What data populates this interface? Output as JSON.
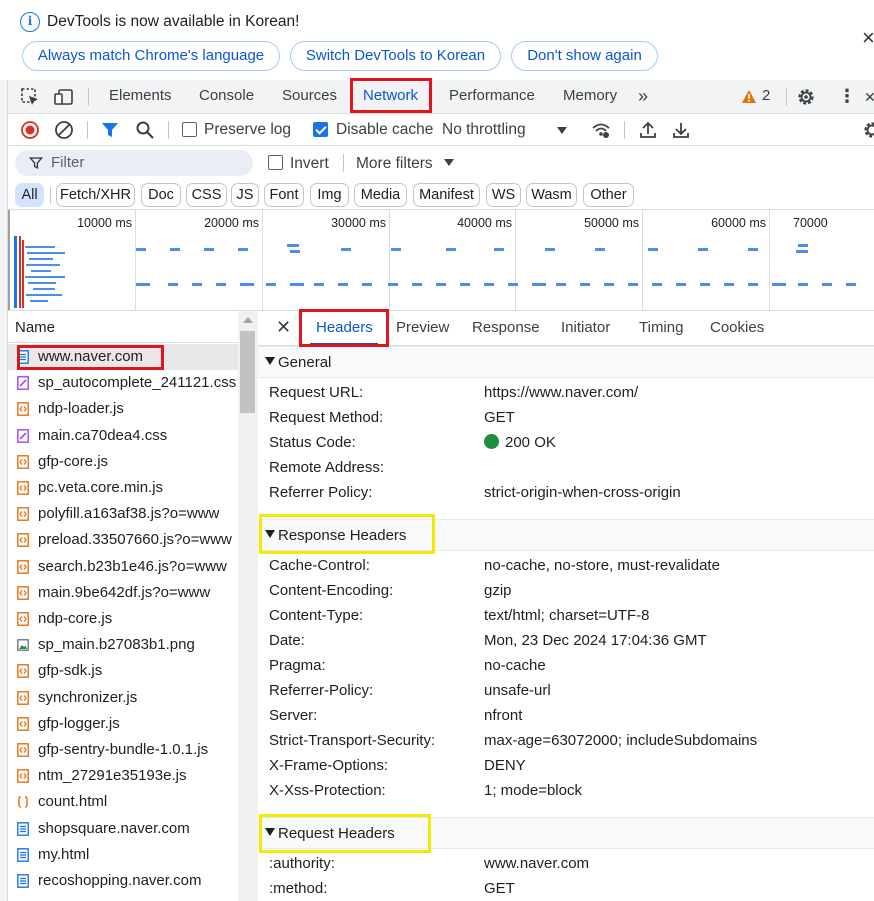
{
  "infobar": {
    "message": "DevTools is now available in Korean!",
    "buttons": [
      "Always match Chrome's language",
      "Switch DevTools to Korean",
      "Don't show again"
    ]
  },
  "tabs": {
    "items": [
      "Elements",
      "Console",
      "Sources",
      "Network",
      "Performance",
      "Memory"
    ],
    "active": "Network",
    "warning_count": "2"
  },
  "toolbar": {
    "preserve_log": "Preserve log",
    "disable_cache": "Disable cache",
    "throttling": "No throttling"
  },
  "filter": {
    "placeholder": "Filter",
    "invert": "Invert",
    "more_filters": "More filters"
  },
  "types": [
    "All",
    "Fetch/XHR",
    "Doc",
    "CSS",
    "JS",
    "Font",
    "Img",
    "Media",
    "Manifest",
    "WS",
    "Wasm",
    "Other"
  ],
  "overview": {
    "ticks": [
      "10000 ms",
      "20000 ms",
      "30000 ms",
      "40000 ms",
      "50000 ms",
      "60000 ms",
      "70000"
    ]
  },
  "requests": {
    "header": "Name",
    "items": [
      {
        "name": "www.naver.com",
        "kind": "doc"
      },
      {
        "name": "sp_autocomplete_241121.css",
        "kind": "css"
      },
      {
        "name": "ndp-loader.js",
        "kind": "js"
      },
      {
        "name": "main.ca70dea4.css",
        "kind": "css"
      },
      {
        "name": "gfp-core.js",
        "kind": "js"
      },
      {
        "name": "pc.veta.core.min.js",
        "kind": "js"
      },
      {
        "name": "polyfill.a163af38.js?o=www",
        "kind": "js"
      },
      {
        "name": "preload.33507660.js?o=www",
        "kind": "js"
      },
      {
        "name": "search.b23b1e46.js?o=www",
        "kind": "js"
      },
      {
        "name": "main.9be642df.js?o=www",
        "kind": "js"
      },
      {
        "name": "ndp-core.js",
        "kind": "js"
      },
      {
        "name": "sp_main.b27083b1.png",
        "kind": "img"
      },
      {
        "name": "gfp-sdk.js",
        "kind": "js"
      },
      {
        "name": "synchronizer.js",
        "kind": "js"
      },
      {
        "name": "gfp-logger.js",
        "kind": "js"
      },
      {
        "name": "gfp-sentry-bundle-1.0.1.js",
        "kind": "js"
      },
      {
        "name": "ntm_27291e35193e.js",
        "kind": "js"
      },
      {
        "name": "count.html",
        "kind": "json"
      },
      {
        "name": "shopsquare.naver.com",
        "kind": "doc"
      },
      {
        "name": "my.html",
        "kind": "doc"
      },
      {
        "name": "recoshopping.naver.com",
        "kind": "doc"
      }
    ]
  },
  "detail": {
    "tabs": [
      "Headers",
      "Preview",
      "Response",
      "Initiator",
      "Timing",
      "Cookies"
    ],
    "general": {
      "title": "General",
      "rows": [
        {
          "k": "Request URL:",
          "v": "https://www.naver.com/"
        },
        {
          "k": "Request Method:",
          "v": "GET"
        },
        {
          "k": "Status Code:",
          "v": "200 OK"
        },
        {
          "k": "Remote Address:",
          "v": ""
        },
        {
          "k": "Referrer Policy:",
          "v": "strict-origin-when-cross-origin"
        }
      ]
    },
    "response_headers": {
      "title": "Response Headers",
      "rows": [
        {
          "k": "Cache-Control:",
          "v": "no-cache, no-store, must-revalidate"
        },
        {
          "k": "Content-Encoding:",
          "v": "gzip"
        },
        {
          "k": "Content-Type:",
          "v": "text/html; charset=UTF-8"
        },
        {
          "k": "Date:",
          "v": "Mon, 23 Dec 2024 17:04:36 GMT"
        },
        {
          "k": "Pragma:",
          "v": "no-cache"
        },
        {
          "k": "Referrer-Policy:",
          "v": "unsafe-url"
        },
        {
          "k": "Server:",
          "v": "nfront"
        },
        {
          "k": "Strict-Transport-Security:",
          "v": "max-age=63072000; includeSubdomains"
        },
        {
          "k": "X-Frame-Options:",
          "v": "DENY"
        },
        {
          "k": "X-Xss-Protection:",
          "v": "1; mode=block"
        }
      ]
    },
    "request_headers": {
      "title": "Request Headers",
      "rows": [
        {
          "k": ":authority:",
          "v": "www.naver.com"
        },
        {
          "k": ":method:",
          "v": "GET"
        }
      ]
    }
  },
  "colors": {
    "accent": "#1a73e8",
    "highlight_red": "#e0161e",
    "highlight_yellow": "#f4ea00",
    "status_ok": "#1e8e3e"
  }
}
